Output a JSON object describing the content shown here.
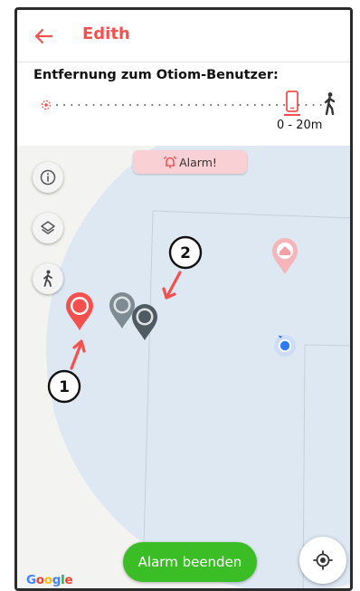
{
  "app_bar": {
    "title": "Edith",
    "back_icon": "arrow-left-icon"
  },
  "distance": {
    "title": "Entfernung zum Otiom-Benutzer:",
    "value": "0 - 20m",
    "phone_icon": "phone-icon",
    "person_icon": "person-walking-icon"
  },
  "map": {
    "alarm_badge": {
      "icon": "alarm-bell-icon",
      "label": "Alarm!"
    },
    "annotations": [
      {
        "label": "1"
      },
      {
        "label": "2"
      }
    ],
    "end_alarm_label": "Alarm beenden",
    "google_logo": [
      "G",
      "o",
      "o",
      "g",
      "l",
      "e"
    ]
  },
  "colors": {
    "accent": "#f4504e",
    "end_alarm": "#3bbd25",
    "marker_red": "#f4504e",
    "marker_gray_light": "#7f8b92",
    "marker_gray_dark": "#4f5b63",
    "user_dot": "#2e7cf6",
    "range_circle": "#dde8f3",
    "google": [
      "#4285F4",
      "#EA4335",
      "#FBBC05",
      "#4285F4",
      "#34A853",
      "#EA4335"
    ]
  }
}
